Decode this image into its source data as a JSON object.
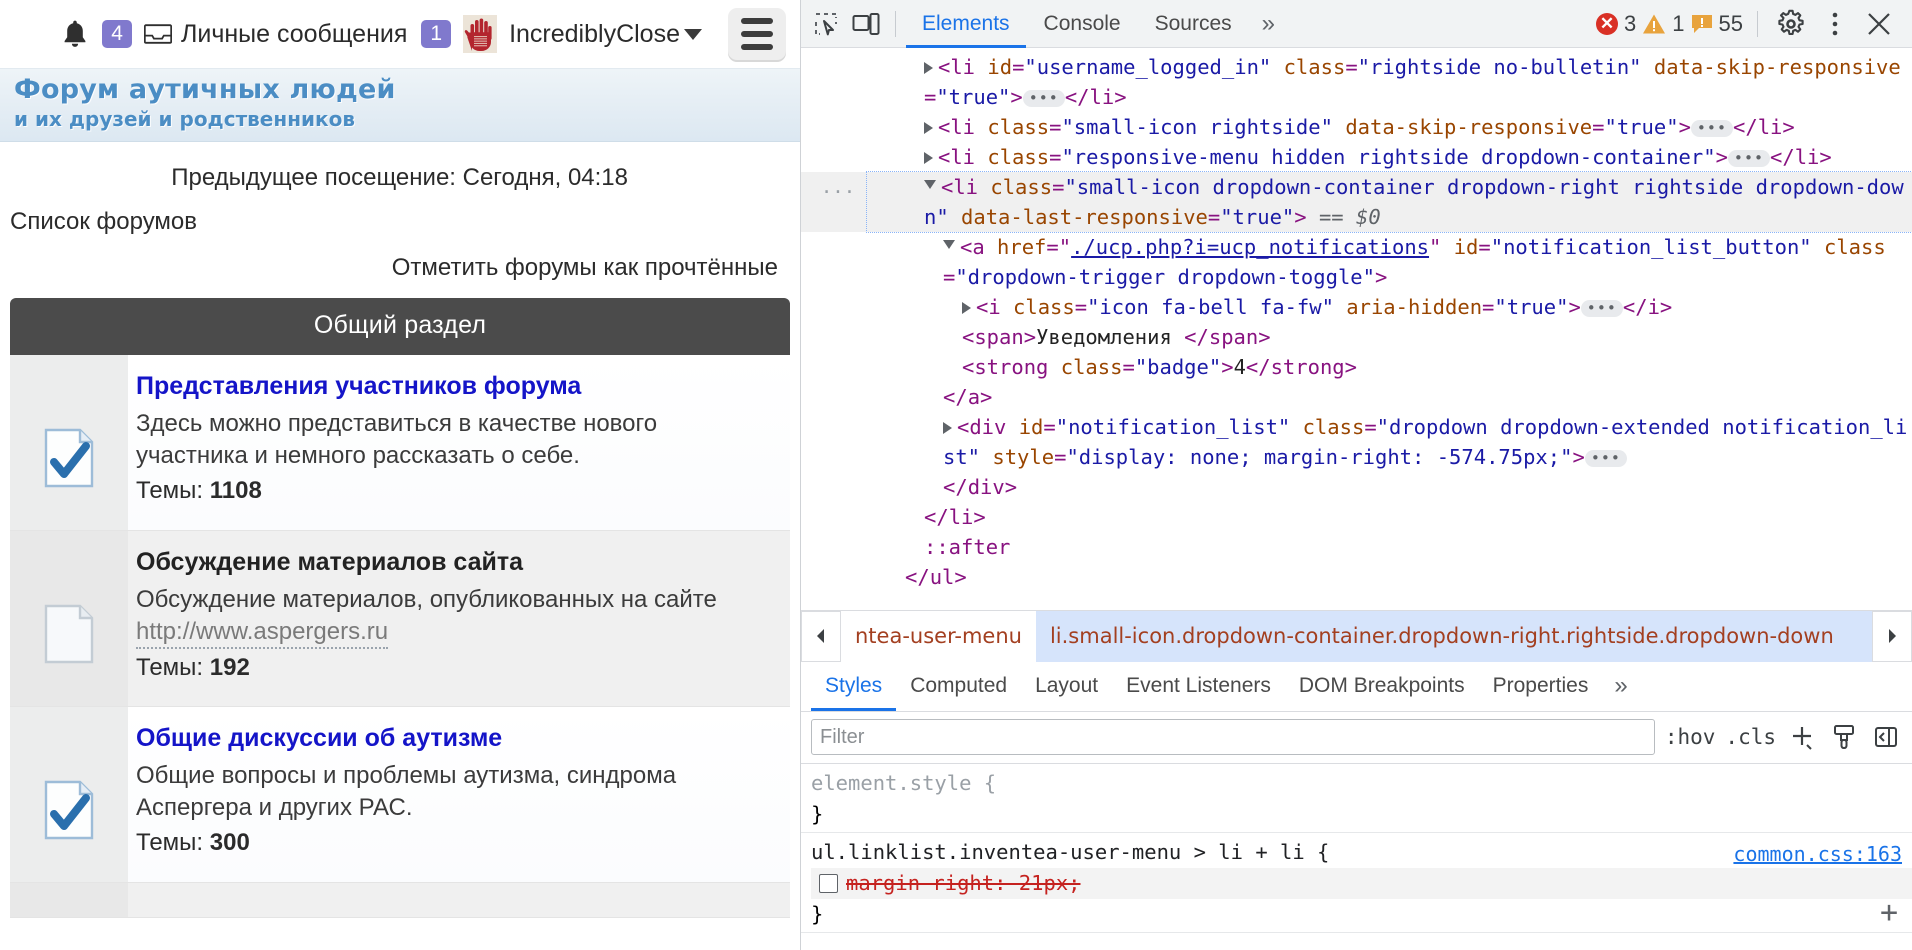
{
  "browser_page": {
    "user_menu": {
      "bell_icon": "bell-icon",
      "notifications_badge": "4",
      "inbox_icon": "inbox-icon",
      "pm_label": "Личные сообщения",
      "pm_badge": "1",
      "avatar_icon": "avatar-hand-image",
      "username": "IncrediblyClose",
      "caret_icon": "chevron-down-icon",
      "menu_button_icon": "hamburger-menu-icon"
    },
    "banner": {
      "line1": "Форум аутичных людей",
      "line2": "и их друзей и родственников"
    },
    "last_visit": "Предыдущее посещение: Сегодня, 04:18",
    "breadcrumb": "Список форумов",
    "mark_read": "Отметить форумы как прочтённые",
    "category_title": "Общий раздел",
    "forums": [
      {
        "icon": "forum-read-checked-icon",
        "title": "Представления участников форума",
        "title_is_link": true,
        "desc": "Здесь можно представиться в качестве нового участника и немного рассказать о себе.",
        "url": "",
        "topics_label": "Темы:",
        "topics_count": "1108"
      },
      {
        "icon": "forum-link-page-icon",
        "title": "Обсуждение материалов сайта",
        "title_is_link": false,
        "desc": "Обсуждение материалов, опубликованных на сайте",
        "url": "http://www.aspergers.ru",
        "topics_label": "Темы:",
        "topics_count": "192"
      },
      {
        "icon": "forum-read-checked-icon",
        "title": "Общие дискуссии об аутизме",
        "title_is_link": true,
        "desc": "Общие вопросы и проблемы аутизма, синдрома Аспергера и других РАС.",
        "url": "",
        "topics_label": "Темы:",
        "topics_count": "300"
      }
    ]
  },
  "devtools": {
    "toolbar": {
      "inspect_icon": "inspect-element-icon",
      "device_icon": "device-toolbar-icon",
      "tabs": [
        {
          "label": "Elements",
          "active": true
        },
        {
          "label": "Console",
          "active": false
        },
        {
          "label": "Sources",
          "active": false
        }
      ],
      "more_tabs_icon": "chevrons-right-icon",
      "error_count": "3",
      "warning_count": "1",
      "info_count": "55",
      "settings_icon": "gear-icon",
      "kebab_icon": "more-vertical-icon",
      "close_icon": "close-icon"
    },
    "dom_lines": [
      {
        "indent": 3,
        "selected": false,
        "gutter": "",
        "parts": [
          {
            "t": "tri"
          },
          {
            "t": "pun",
            "v": "<"
          },
          {
            "t": "tg",
            "v": "li"
          },
          {
            "t": "sp"
          },
          {
            "t": "at",
            "v": "id"
          },
          {
            "t": "pun",
            "v": "="
          },
          {
            "t": "av",
            "v": "\"username_logged_in\""
          },
          {
            "t": "sp"
          },
          {
            "t": "at",
            "v": "class"
          },
          {
            "t": "pun",
            "v": "="
          },
          {
            "t": "av",
            "v": "\"rightside no-bulletin\""
          },
          {
            "t": "sp"
          },
          {
            "t": "at",
            "v": "data-skip-responsive"
          },
          {
            "t": "pun",
            "v": "="
          },
          {
            "t": "av",
            "v": "\"true\""
          },
          {
            "t": "pun",
            "v": ">"
          },
          {
            "t": "ellip"
          },
          {
            "t": "pun",
            "v": "</"
          },
          {
            "t": "tg",
            "v": "li"
          },
          {
            "t": "pun",
            "v": ">"
          }
        ]
      },
      {
        "indent": 3,
        "selected": false,
        "gutter": "",
        "parts": [
          {
            "t": "tri"
          },
          {
            "t": "pun",
            "v": "<"
          },
          {
            "t": "tg",
            "v": "li"
          },
          {
            "t": "sp"
          },
          {
            "t": "at",
            "v": "class"
          },
          {
            "t": "pun",
            "v": "="
          },
          {
            "t": "av",
            "v": "\"small-icon rightside\""
          },
          {
            "t": "sp"
          },
          {
            "t": "at",
            "v": "data-skip-responsive"
          },
          {
            "t": "pun",
            "v": "="
          },
          {
            "t": "av",
            "v": "\"true\""
          },
          {
            "t": "pun",
            "v": ">"
          },
          {
            "t": "ellip"
          },
          {
            "t": "pun",
            "v": "</"
          },
          {
            "t": "tg",
            "v": "li"
          },
          {
            "t": "pun",
            "v": ">"
          }
        ]
      },
      {
        "indent": 3,
        "selected": false,
        "gutter": "",
        "parts": [
          {
            "t": "tri"
          },
          {
            "t": "pun",
            "v": "<"
          },
          {
            "t": "tg",
            "v": "li"
          },
          {
            "t": "sp"
          },
          {
            "t": "at",
            "v": "class"
          },
          {
            "t": "pun",
            "v": "="
          },
          {
            "t": "av",
            "v": "\"responsive-menu hidden rightside dropdown-container\""
          },
          {
            "t": "pun",
            "v": ">"
          },
          {
            "t": "ellip"
          },
          {
            "t": "pun",
            "v": "</"
          },
          {
            "t": "tg",
            "v": "li"
          },
          {
            "t": "pun",
            "v": ">"
          }
        ]
      },
      {
        "indent": 3,
        "selected": true,
        "gutter": "...",
        "parts": [
          {
            "t": "tri-open"
          },
          {
            "t": "pun",
            "v": "<"
          },
          {
            "t": "tg",
            "v": "li"
          },
          {
            "t": "sp"
          },
          {
            "t": "at",
            "v": "class"
          },
          {
            "t": "pun",
            "v": "="
          },
          {
            "t": "av",
            "v": "\"small-icon dropdown-container dropdown-right rightside dropdown-down\""
          },
          {
            "t": "sp"
          },
          {
            "t": "at",
            "v": "data-last-responsive"
          },
          {
            "t": "pun",
            "v": "="
          },
          {
            "t": "av",
            "v": "\"true\""
          },
          {
            "t": "pun",
            "v": ">"
          },
          {
            "t": "dim",
            "v": " == $0"
          }
        ]
      },
      {
        "indent": 4,
        "selected": false,
        "gutter": "",
        "parts": [
          {
            "t": "tri-open"
          },
          {
            "t": "pun",
            "v": "<"
          },
          {
            "t": "tg",
            "v": "a"
          },
          {
            "t": "sp"
          },
          {
            "t": "at",
            "v": "href"
          },
          {
            "t": "pun",
            "v": "="
          },
          {
            "t": "pun",
            "v": "\""
          },
          {
            "t": "lnk",
            "v": "./ucp.php?i=ucp_notifications"
          },
          {
            "t": "pun",
            "v": "\""
          },
          {
            "t": "sp"
          },
          {
            "t": "at",
            "v": "id"
          },
          {
            "t": "pun",
            "v": "="
          },
          {
            "t": "av",
            "v": "\"notification_list_button\""
          },
          {
            "t": "sp"
          },
          {
            "t": "at",
            "v": "class"
          },
          {
            "t": "pun",
            "v": "="
          },
          {
            "t": "av",
            "v": "\"dropdown-trigger dropdown-toggle\""
          },
          {
            "t": "pun",
            "v": ">"
          }
        ]
      },
      {
        "indent": 5,
        "selected": false,
        "gutter": "",
        "parts": [
          {
            "t": "tri"
          },
          {
            "t": "pun",
            "v": "<"
          },
          {
            "t": "tg",
            "v": "i"
          },
          {
            "t": "sp"
          },
          {
            "t": "at",
            "v": "class"
          },
          {
            "t": "pun",
            "v": "="
          },
          {
            "t": "av",
            "v": "\"icon fa-bell fa-fw\""
          },
          {
            "t": "sp"
          },
          {
            "t": "at",
            "v": "aria-hidden"
          },
          {
            "t": "pun",
            "v": "="
          },
          {
            "t": "av",
            "v": "\"true\""
          },
          {
            "t": "pun",
            "v": ">"
          },
          {
            "t": "ellip"
          },
          {
            "t": "pun",
            "v": "</"
          },
          {
            "t": "tg",
            "v": "i"
          },
          {
            "t": "pun",
            "v": ">"
          }
        ]
      },
      {
        "indent": 5,
        "selected": false,
        "gutter": "",
        "parts": [
          {
            "t": "pun",
            "v": "<"
          },
          {
            "t": "tg",
            "v": "span"
          },
          {
            "t": "pun",
            "v": ">"
          },
          {
            "t": "txt",
            "v": "Уведомления "
          },
          {
            "t": "pun",
            "v": "</"
          },
          {
            "t": "tg",
            "v": "span"
          },
          {
            "t": "pun",
            "v": ">"
          }
        ]
      },
      {
        "indent": 5,
        "selected": false,
        "gutter": "",
        "parts": [
          {
            "t": "pun",
            "v": "<"
          },
          {
            "t": "tg",
            "v": "strong"
          },
          {
            "t": "sp"
          },
          {
            "t": "at",
            "v": "class"
          },
          {
            "t": "pun",
            "v": "="
          },
          {
            "t": "av",
            "v": "\"badge\""
          },
          {
            "t": "pun",
            "v": ">"
          },
          {
            "t": "txt",
            "v": "4"
          },
          {
            "t": "pun",
            "v": "</"
          },
          {
            "t": "tg",
            "v": "strong"
          },
          {
            "t": "pun",
            "v": ">"
          }
        ]
      },
      {
        "indent": 4,
        "selected": false,
        "gutter": "",
        "parts": [
          {
            "t": "pun",
            "v": "</"
          },
          {
            "t": "tg",
            "v": "a"
          },
          {
            "t": "pun",
            "v": ">"
          }
        ]
      },
      {
        "indent": 4,
        "selected": false,
        "gutter": "",
        "parts": [
          {
            "t": "tri"
          },
          {
            "t": "pun",
            "v": "<"
          },
          {
            "t": "tg",
            "v": "div"
          },
          {
            "t": "sp"
          },
          {
            "t": "at",
            "v": "id"
          },
          {
            "t": "pun",
            "v": "="
          },
          {
            "t": "av",
            "v": "\"notification_list\""
          },
          {
            "t": "sp"
          },
          {
            "t": "at",
            "v": "class"
          },
          {
            "t": "pun",
            "v": "="
          },
          {
            "t": "av",
            "v": "\"dropdown dropdown-extended notification_list\""
          },
          {
            "t": "sp"
          },
          {
            "t": "at",
            "v": "style"
          },
          {
            "t": "pun",
            "v": "="
          },
          {
            "t": "av",
            "v": "\"display: none; margin-right: -574.75px;\""
          },
          {
            "t": "pun",
            "v": ">"
          },
          {
            "t": "ellip"
          }
        ]
      },
      {
        "indent": 4,
        "selected": false,
        "gutter": "",
        "parts": [
          {
            "t": "pun",
            "v": "</"
          },
          {
            "t": "tg",
            "v": "div"
          },
          {
            "t": "pun",
            "v": ">"
          }
        ]
      },
      {
        "indent": 3,
        "selected": false,
        "gutter": "",
        "parts": [
          {
            "t": "pun",
            "v": "</"
          },
          {
            "t": "tg",
            "v": "li"
          },
          {
            "t": "pun",
            "v": ">"
          }
        ]
      },
      {
        "indent": 3,
        "selected": false,
        "gutter": "",
        "parts": [
          {
            "t": "dim2",
            "v": "::after"
          }
        ]
      },
      {
        "indent": 2,
        "selected": false,
        "gutter": "",
        "parts": [
          {
            "t": "pun",
            "v": "</"
          },
          {
            "t": "tg",
            "v": "ul"
          },
          {
            "t": "pun",
            "v": ">"
          }
        ]
      }
    ],
    "breadcrumbs": {
      "left_arrow_icon": "chevron-left-icon",
      "right_arrow_icon": "chevron-right-icon",
      "items": [
        {
          "label": "ntea-user-menu",
          "active": false
        },
        {
          "label": "li.small-icon.dropdown-container.dropdown-right.rightside.dropdown-down",
          "active": true
        }
      ]
    },
    "sidebar_tabs": [
      {
        "label": "Styles",
        "active": true
      },
      {
        "label": "Computed",
        "active": false
      },
      {
        "label": "Layout",
        "active": false
      },
      {
        "label": "Event Listeners",
        "active": false
      },
      {
        "label": "DOM Breakpoints",
        "active": false
      },
      {
        "label": "Properties",
        "active": false
      }
    ],
    "sidebar_more_icon": "chevrons-right-icon",
    "filter": {
      "placeholder": "Filter",
      "value": "",
      "hov_label": ":hov",
      "cls_label": ".cls",
      "new_rule_icon": "plus-new-style-rule-icon",
      "classes_icon": "paint-brush-icon",
      "toggle_pane_icon": "toggle-sidebar-icon"
    },
    "styles": [
      {
        "selector": "element.style {",
        "muted": true,
        "source": "",
        "declarations": [],
        "close": "}"
      },
      {
        "selector": "ul.linklist.inventea-user-menu > li + li {",
        "muted": false,
        "source": "common.css:163",
        "declarations": [
          {
            "property": "margin-right",
            "value": "21px;",
            "disabled": true,
            "checked": false
          }
        ],
        "close": "}"
      }
    ]
  }
}
